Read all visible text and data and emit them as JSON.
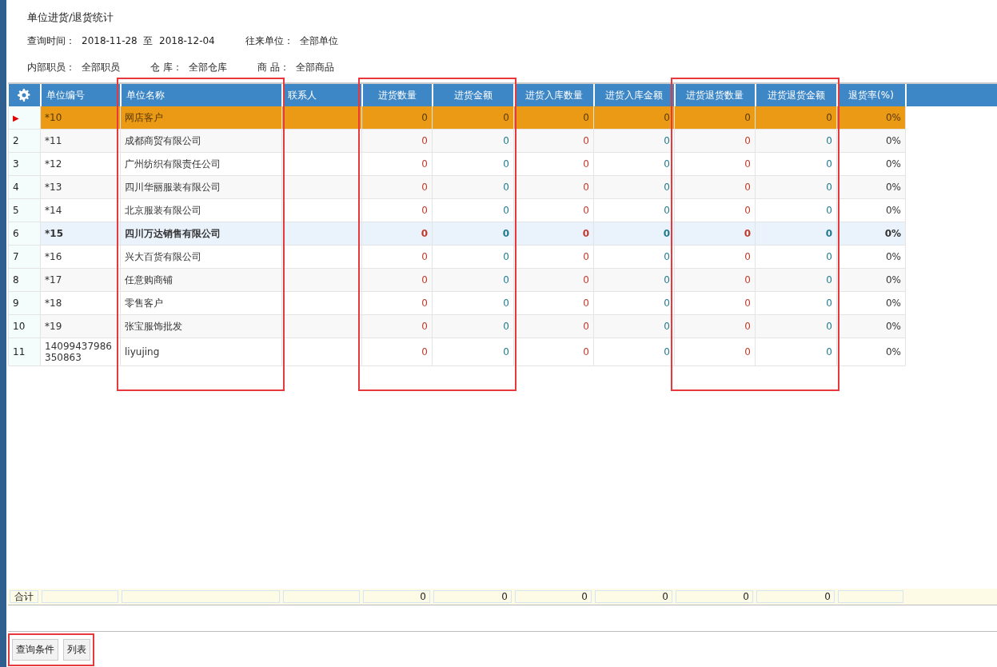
{
  "title": "单位进货/退货统计",
  "filters": [
    [
      {
        "label": "查询时间：",
        "value": "2018-11-28  至  2018-12-04"
      },
      {
        "label": "往来单位：",
        "value": "全部单位"
      }
    ],
    [
      {
        "label": "内部职员：",
        "value": "全部职员"
      },
      {
        "label": "仓 库：",
        "value": "全部仓库"
      },
      {
        "label": "商 品：",
        "value": "全部商品"
      }
    ]
  ],
  "table": {
    "columns": [
      {
        "label": "单位编号",
        "kind": "text",
        "framed": false
      },
      {
        "label": "单位名称",
        "kind": "text",
        "framed": true
      },
      {
        "label": "联系人",
        "kind": "text",
        "framed": false
      },
      {
        "label": "进货数量",
        "kind": "quantity",
        "framed": true
      },
      {
        "label": "进货金额",
        "kind": "amount",
        "framed": true
      },
      {
        "label": "进货入库数量",
        "kind": "quantity",
        "framed": false
      },
      {
        "label": "进货入库金额",
        "kind": "amount",
        "framed": false
      },
      {
        "label": "进货退货数量",
        "kind": "quantity",
        "framed": true
      },
      {
        "label": "进货退货金额",
        "kind": "amount",
        "framed": true
      },
      {
        "label": "退货率(%)",
        "kind": "rate",
        "framed": false
      }
    ],
    "rows": [
      {
        "row_header": "▶",
        "selected": true,
        "hovered": false,
        "cells": [
          "*10",
          "网店客户",
          "",
          "0",
          "0",
          "0",
          "0",
          "0",
          "0",
          "0%"
        ]
      },
      {
        "row_header": "2",
        "selected": false,
        "hovered": false,
        "cells": [
          "*11",
          "成都商贸有限公司",
          "",
          "0",
          "0",
          "0",
          "0",
          "0",
          "0",
          "0%"
        ]
      },
      {
        "row_header": "3",
        "selected": false,
        "hovered": false,
        "cells": [
          "*12",
          "广州纺织有限责任公司",
          "",
          "0",
          "0",
          "0",
          "0",
          "0",
          "0",
          "0%"
        ]
      },
      {
        "row_header": "4",
        "selected": false,
        "hovered": false,
        "cells": [
          "*13",
          "四川华丽服装有限公司",
          "",
          "0",
          "0",
          "0",
          "0",
          "0",
          "0",
          "0%"
        ]
      },
      {
        "row_header": "5",
        "selected": false,
        "hovered": false,
        "cells": [
          "*14",
          "北京服装有限公司",
          "",
          "0",
          "0",
          "0",
          "0",
          "0",
          "0",
          "0%"
        ]
      },
      {
        "row_header": "6",
        "selected": false,
        "hovered": true,
        "cells": [
          "*15",
          "四川万达销售有限公司",
          "",
          "0",
          "0",
          "0",
          "0",
          "0",
          "0",
          "0%"
        ]
      },
      {
        "row_header": "7",
        "selected": false,
        "hovered": false,
        "cells": [
          "*16",
          "兴大百货有限公司",
          "",
          "0",
          "0",
          "0",
          "0",
          "0",
          "0",
          "0%"
        ]
      },
      {
        "row_header": "8",
        "selected": false,
        "hovered": false,
        "cells": [
          "*17",
          "任意购商铺",
          "",
          "0",
          "0",
          "0",
          "0",
          "0",
          "0",
          "0%"
        ]
      },
      {
        "row_header": "9",
        "selected": false,
        "hovered": false,
        "cells": [
          "*18",
          "零售客户",
          "",
          "0",
          "0",
          "0",
          "0",
          "0",
          "0",
          "0%"
        ]
      },
      {
        "row_header": "10",
        "selected": false,
        "hovered": false,
        "cells": [
          "*19",
          "张宝服饰批发",
          "",
          "0",
          "0",
          "0",
          "0",
          "0",
          "0",
          "0%"
        ]
      },
      {
        "row_header": "11",
        "selected": false,
        "hovered": false,
        "cells": [
          "14099437986350863",
          "liyujing",
          "",
          "0",
          "0",
          "0",
          "0",
          "0",
          "0",
          "0%"
        ]
      }
    ],
    "totals": {
      "label": "合计",
      "cells": [
        "",
        "",
        "",
        "0",
        "0",
        "0",
        "0",
        "0",
        "0",
        ""
      ]
    }
  },
  "toolbar": {
    "framed": true,
    "buttons": [
      "查询条件",
      "列表"
    ]
  }
}
